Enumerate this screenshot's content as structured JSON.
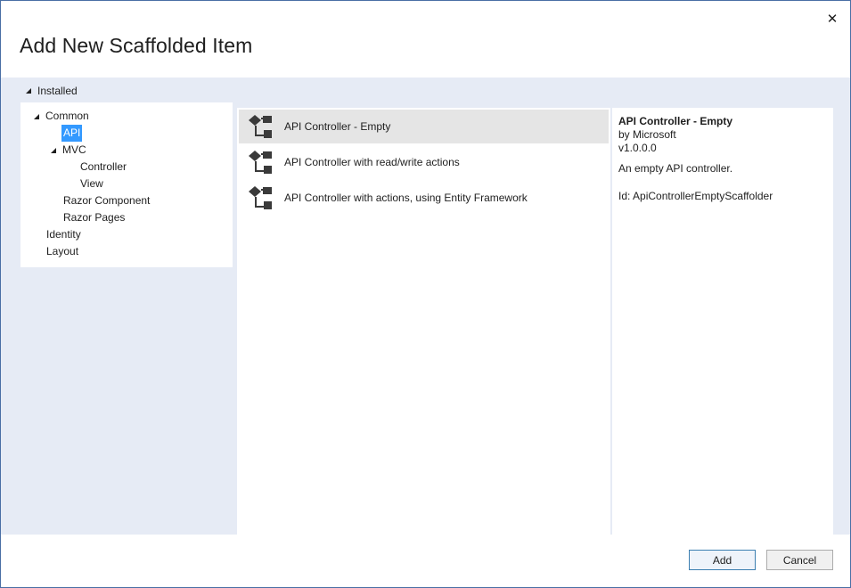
{
  "dialog": {
    "title": "Add New Scaffolded Item",
    "close_glyph": "✕"
  },
  "tree": {
    "root_label": "Installed",
    "items": [
      {
        "label": "Common",
        "expanded": true,
        "selected": false
      },
      {
        "label": "API",
        "expanded": null,
        "selected": true
      },
      {
        "label": "MVC",
        "expanded": true,
        "selected": false
      },
      {
        "label": "Controller",
        "expanded": null,
        "selected": false
      },
      {
        "label": "View",
        "expanded": null,
        "selected": false
      },
      {
        "label": "Razor Component",
        "expanded": null,
        "selected": false
      },
      {
        "label": "Razor Pages",
        "expanded": null,
        "selected": false
      },
      {
        "label": "Identity",
        "expanded": null,
        "selected": false
      },
      {
        "label": "Layout",
        "expanded": null,
        "selected": false
      }
    ]
  },
  "templates": [
    {
      "label": "API Controller - Empty",
      "icon": "controller-icon",
      "selected": true
    },
    {
      "label": "API Controller with read/write actions",
      "icon": "controller-icon",
      "selected": false
    },
    {
      "label": "API Controller with actions, using Entity Framework",
      "icon": "controller-icon",
      "selected": false
    }
  ],
  "details": {
    "title": "API Controller - Empty",
    "author": "by Microsoft",
    "version": "v1.0.0.0",
    "description": "An empty API controller.",
    "id": "Id: ApiControllerEmptyScaffolder"
  },
  "buttons": {
    "add": "Add",
    "cancel": "Cancel"
  },
  "colors": {
    "accent": "#3399ff",
    "panel_bg": "#e6ebf5",
    "selected_item_bg": "#e5e5e5"
  }
}
